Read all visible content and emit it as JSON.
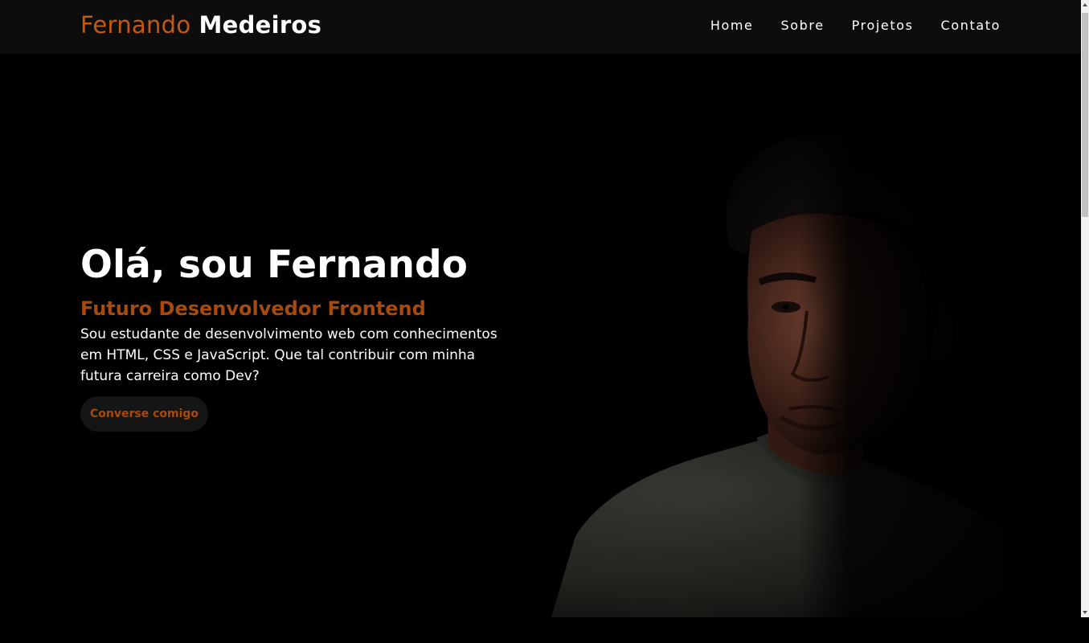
{
  "header": {
    "logo_first": "Fernando",
    "logo_last": "Medeiros",
    "nav": [
      "Home",
      "Sobre",
      "Projetos",
      "Contato"
    ]
  },
  "hero": {
    "title": "Olá, sou Fernando",
    "subtitle": "Futuro Desenvolvedor Frontend",
    "description": "Sou estudante de desenvolvimento web com conhecimentos em HTML, CSS e JavaScript. Que tal contribuir com minha futura carreira como Dev?",
    "cta_label": "Converse comigo"
  },
  "colors": {
    "accent": "#c25a14",
    "accent_dark": "#a84a0c",
    "header_bg": "#0d0d0d",
    "page_bg": "#000000"
  }
}
